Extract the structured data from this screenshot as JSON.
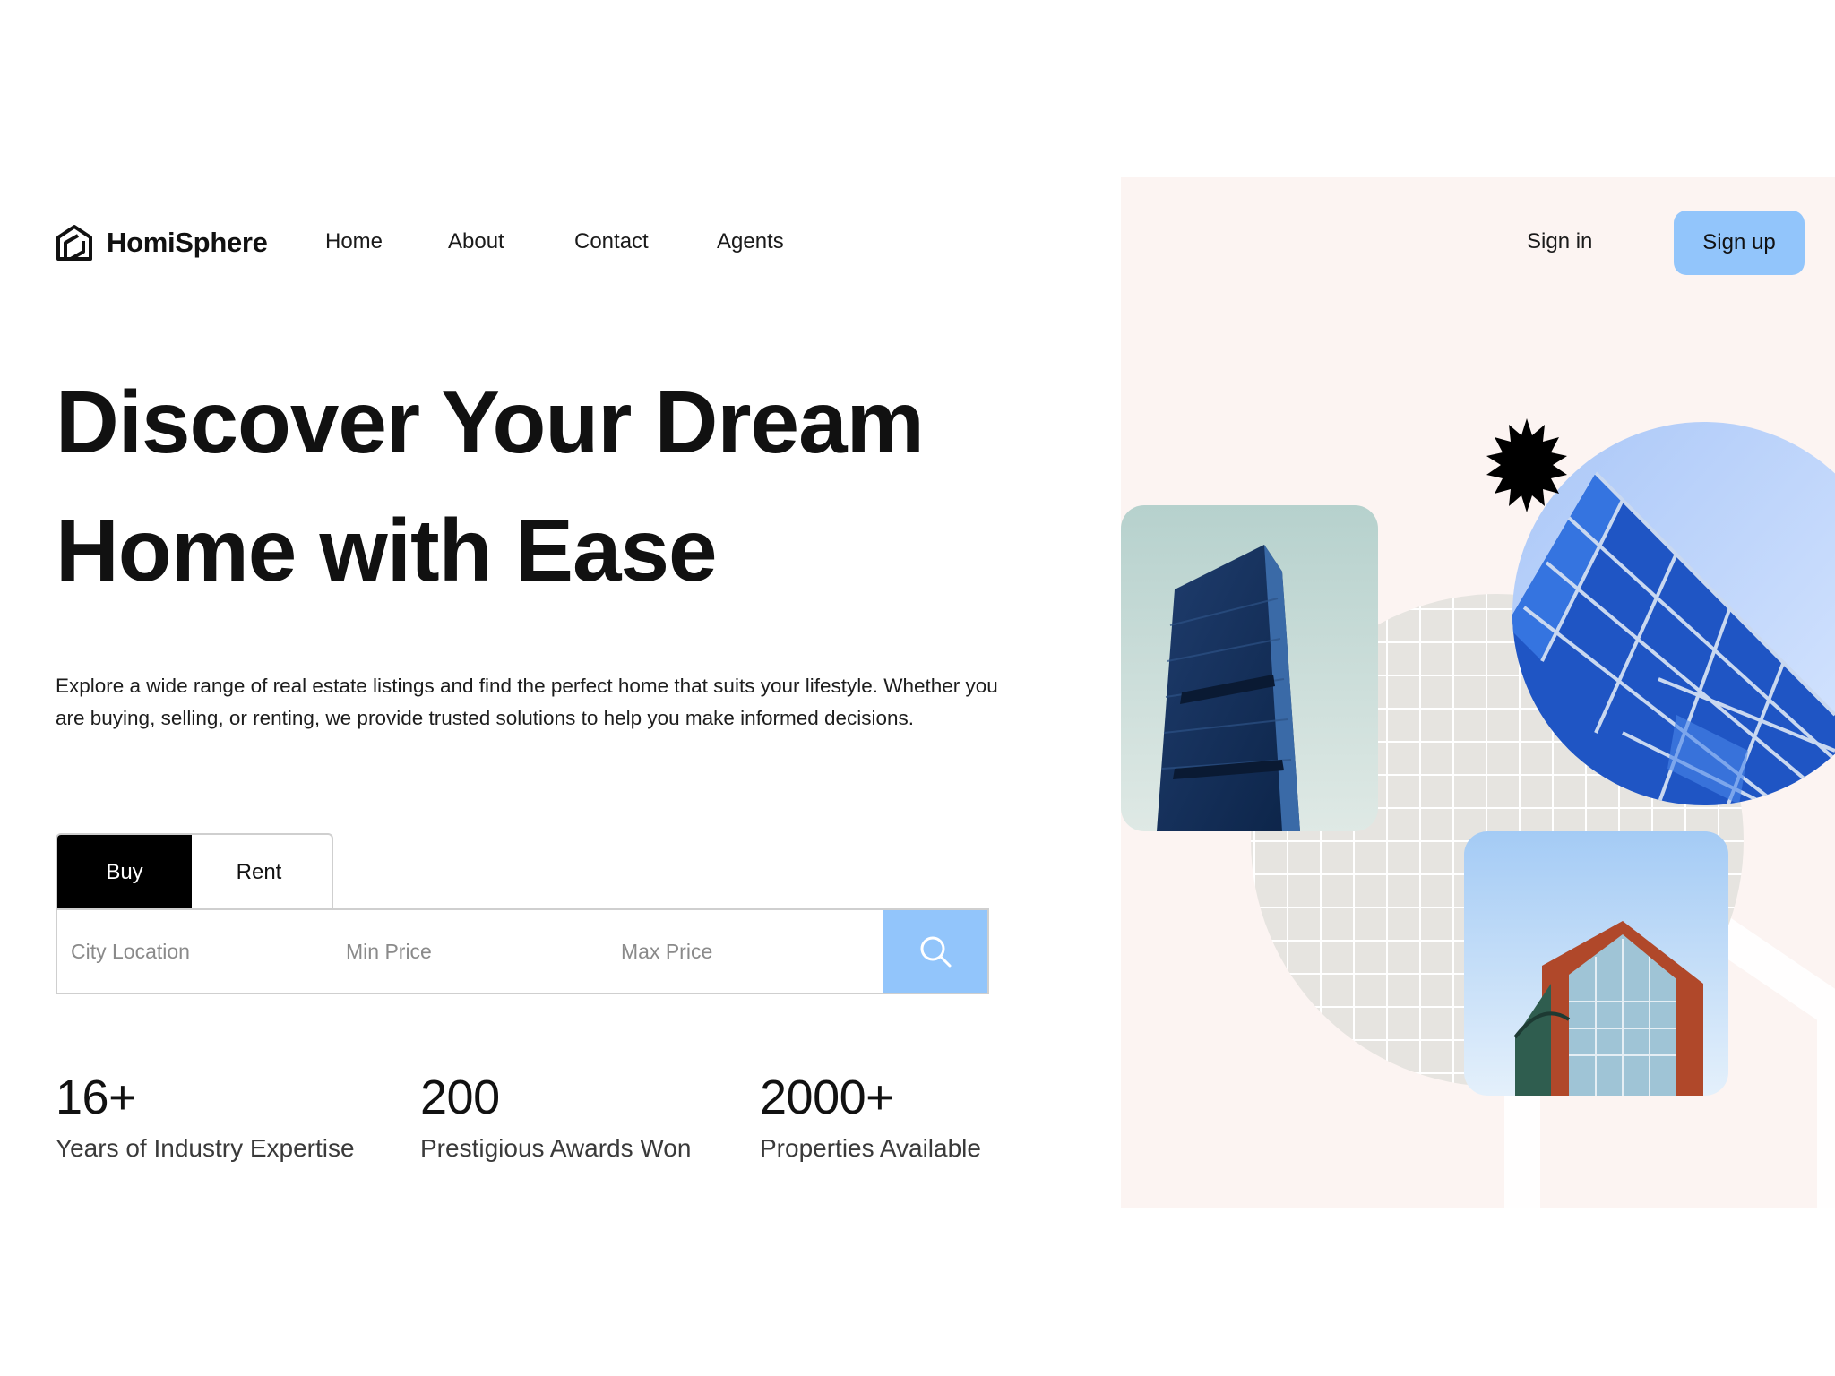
{
  "brand": {
    "name": "HomiSphere",
    "logo_icon": "house-logo-icon"
  },
  "nav": {
    "items": [
      {
        "label": "Home"
      },
      {
        "label": "About"
      },
      {
        "label": "Contact"
      },
      {
        "label": "Agents"
      }
    ]
  },
  "auth": {
    "signin_label": "Sign in",
    "signup_label": "Sign up"
  },
  "hero": {
    "headline_line1": "Discover Your Dream",
    "headline_line2": "Home with Ease",
    "description": "Explore a wide range of real estate listings and find the perfect home that suits your lifestyle. Whether you are buying, selling, or renting, we provide trusted solutions to help you make informed decisions."
  },
  "search": {
    "tabs": [
      {
        "label": "Buy"
      },
      {
        "label": "Rent"
      }
    ],
    "active_tab": "Buy",
    "fields": {
      "city": {
        "placeholder": "City Location",
        "value": ""
      },
      "min_price": {
        "placeholder": "Min Price",
        "value": ""
      },
      "max_price": {
        "placeholder": "Max Price",
        "value": ""
      }
    },
    "button_icon": "search-icon"
  },
  "stats": [
    {
      "value": "16+",
      "label": "Years of Industry Expertise"
    },
    {
      "value": "200",
      "label": "Prestigious Awards Won"
    },
    {
      "value": "2000+",
      "label": "Properties Available"
    }
  ],
  "colors": {
    "accent": "#92c5fb",
    "panel_bg": "#fcf4f2",
    "text": "#111111",
    "grid_circle": "#e6e4e0"
  }
}
